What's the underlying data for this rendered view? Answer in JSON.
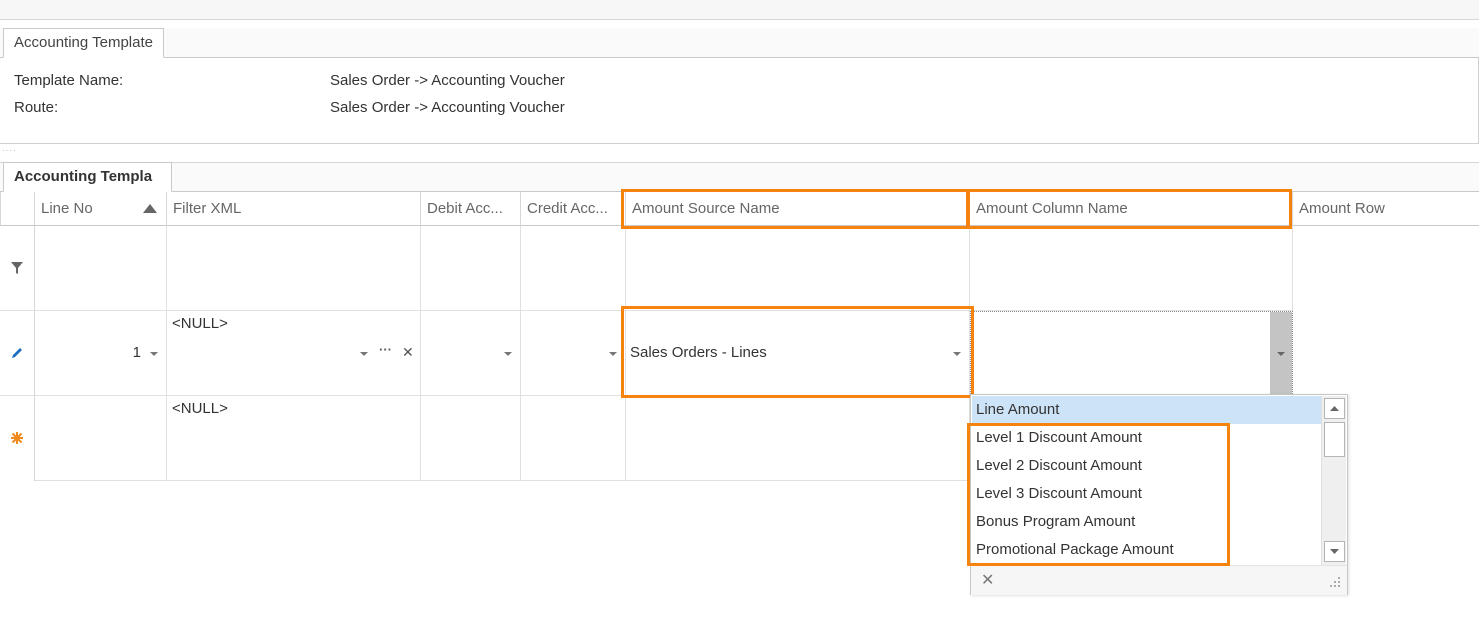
{
  "template_tab": {
    "label": "Accounting Template"
  },
  "details": {
    "template_name_label": "Template Name:",
    "template_name_value": "Sales Order -> Accounting Voucher",
    "route_label": "Route:",
    "route_value": "Sales Order -> Accounting Voucher"
  },
  "grid_tab": {
    "label": "Accounting Templa"
  },
  "columns": {
    "line_no": "Line No",
    "filter_xml": "Filter XML",
    "debit_account": "Debit Acc...",
    "credit_account": "Credit Acc...",
    "amount_source_name": "Amount Source Name",
    "amount_column_name": "Amount Column Name",
    "amount_row": "Amount Row"
  },
  "rows": {
    "edit_row": {
      "line_no": "1",
      "filter_xml": "<NULL>",
      "ellipsis": "···",
      "clear": "✕",
      "amount_source_name": "Sales Orders - Lines"
    },
    "new_row": {
      "filter_xml": "<NULL>"
    }
  },
  "dropdown": {
    "items": [
      "Line Amount",
      "Level 1 Discount Amount",
      "Level 2 Discount Amount",
      "Level 3 Discount Amount",
      "Bonus Program Amount",
      "Promotional Package Amount"
    ],
    "selected_index": 0,
    "clear_glyph": "✕"
  },
  "icons": {
    "sort_ascending": "sort-ascending-icon",
    "filter": "filter-icon",
    "edit": "pencil-icon",
    "new_row": "asterisk-icon"
  },
  "colors": {
    "highlight": "#f7830f",
    "selection": "#cde3f7",
    "edit_icon": "#1e6fbf",
    "new_row_icon": "#f08a1c"
  }
}
